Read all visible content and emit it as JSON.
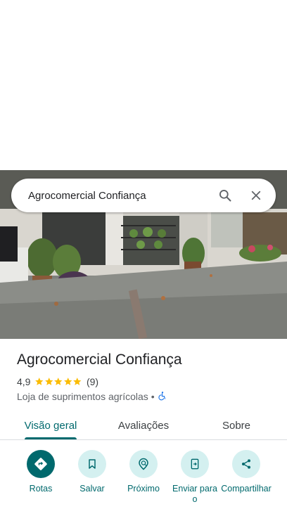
{
  "search": {
    "query": "Agrocomercial Confiança",
    "search_icon": "search-icon",
    "close_icon": "close-icon"
  },
  "place": {
    "name": "Agrocomercial Confiança",
    "rating": "4,9",
    "stars": 5,
    "review_count": "(9)",
    "category": "Loja de suprimentos agrícolas",
    "separator": "•",
    "accessibility_icon": "wheelchair-icon"
  },
  "tabs": [
    {
      "label": "Visão geral",
      "active": true
    },
    {
      "label": "Avaliações",
      "active": false
    },
    {
      "label": "Sobre",
      "active": false
    }
  ],
  "actions": [
    {
      "label": "Rotas",
      "icon": "directions-icon",
      "primary": true
    },
    {
      "label": "Salvar",
      "icon": "bookmark-icon",
      "primary": false
    },
    {
      "label": "Próximo",
      "icon": "nearby-icon",
      "primary": false
    },
    {
      "label": "Enviar para o",
      "icon": "send-to-phone-icon",
      "primary": false
    },
    {
      "label": "Compartilhar",
      "icon": "share-icon",
      "primary": false
    }
  ],
  "colors": {
    "accent": "#00696d",
    "accent_light": "#d4f0f0",
    "star": "#fbbc04",
    "accessibility": "#1a73e8"
  }
}
